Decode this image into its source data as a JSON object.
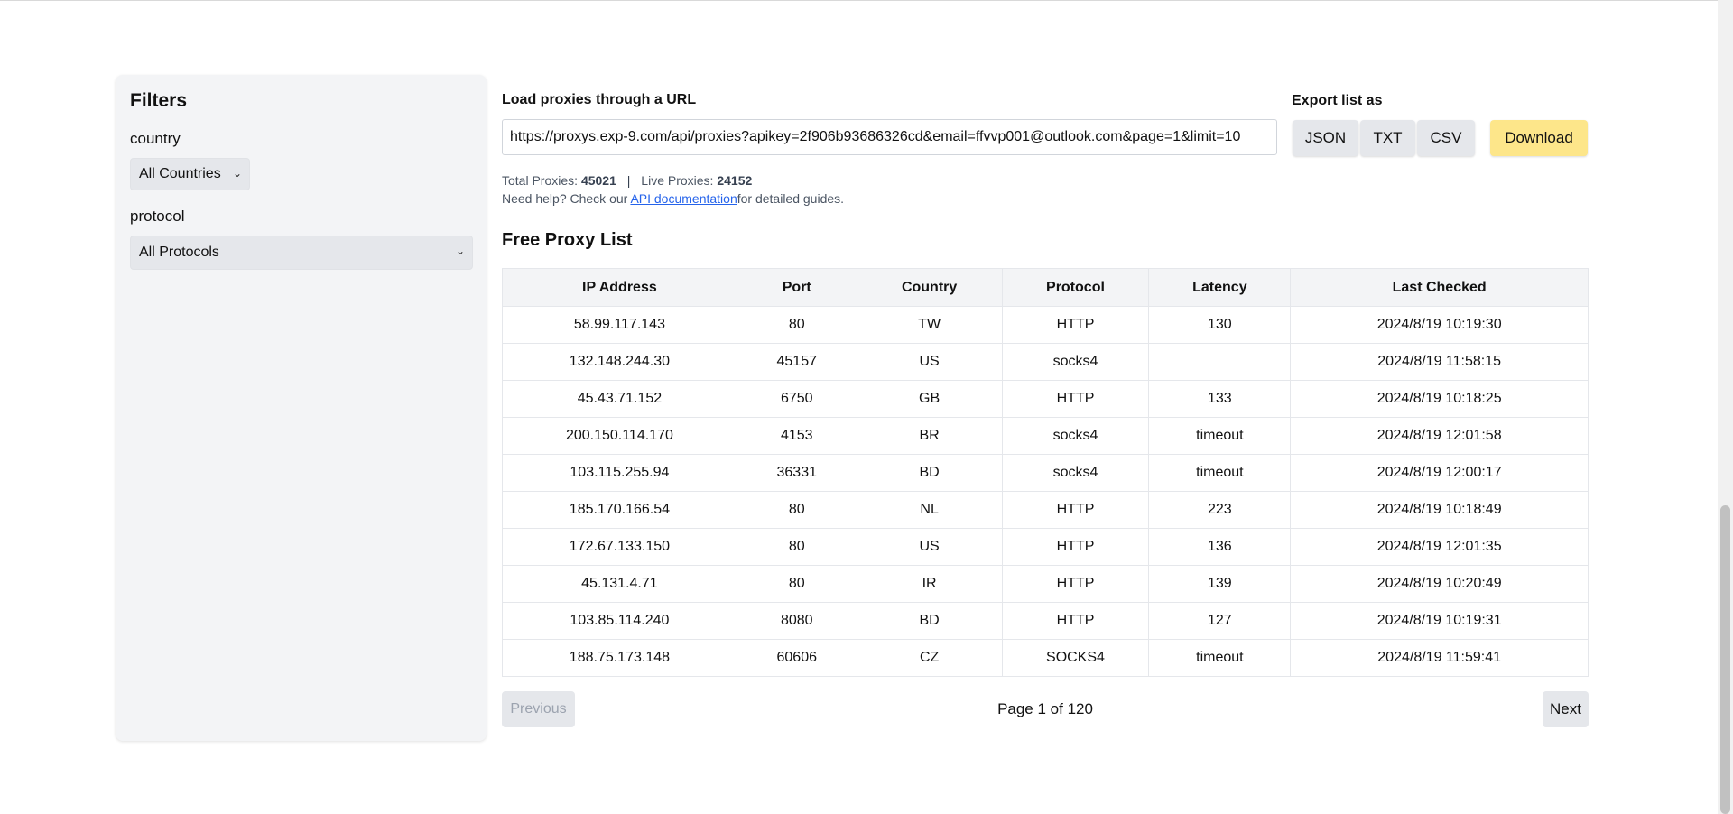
{
  "filters": {
    "title": "Filters",
    "country_label": "country",
    "country_value": "All Countries",
    "protocol_label": "protocol",
    "protocol_value": "All Protocols"
  },
  "url_loader": {
    "label": "Load proxies through a URL",
    "value": "https://proxys.exp-9.com/api/proxies?apikey=2f906b93686326cd&email=ffvvp001@outlook.com&page=1&limit=10"
  },
  "export": {
    "label": "Export list as",
    "formats": [
      "JSON",
      "TXT",
      "CSV"
    ],
    "download_label": "Download"
  },
  "stats": {
    "total_label": "Total Proxies:",
    "total_value": "45021",
    "separator": "|",
    "live_label": "Live Proxies:",
    "live_value": "24152"
  },
  "help": {
    "prefix": "Need help? Check our ",
    "link_text": "API documentation",
    "suffix": "for detailed guides."
  },
  "list_title": "Free Proxy List",
  "table": {
    "headers": [
      "IP Address",
      "Port",
      "Country",
      "Protocol",
      "Latency",
      "Last Checked"
    ],
    "rows": [
      [
        "58.99.117.143",
        "80",
        "TW",
        "HTTP",
        "130",
        "2024/8/19 10:19:30"
      ],
      [
        "132.148.244.30",
        "45157",
        "US",
        "socks4",
        "",
        "2024/8/19 11:58:15"
      ],
      [
        "45.43.71.152",
        "6750",
        "GB",
        "HTTP",
        "133",
        "2024/8/19 10:18:25"
      ],
      [
        "200.150.114.170",
        "4153",
        "BR",
        "socks4",
        "timeout",
        "2024/8/19 12:01:58"
      ],
      [
        "103.115.255.94",
        "36331",
        "BD",
        "socks4",
        "timeout",
        "2024/8/19 12:00:17"
      ],
      [
        "185.170.166.54",
        "80",
        "NL",
        "HTTP",
        "223",
        "2024/8/19 10:18:49"
      ],
      [
        "172.67.133.150",
        "80",
        "US",
        "HTTP",
        "136",
        "2024/8/19 12:01:35"
      ],
      [
        "45.131.4.71",
        "80",
        "IR",
        "HTTP",
        "139",
        "2024/8/19 10:20:49"
      ],
      [
        "103.85.114.240",
        "8080",
        "BD",
        "HTTP",
        "127",
        "2024/8/19 10:19:31"
      ],
      [
        "188.75.173.148",
        "60606",
        "CZ",
        "SOCKS4",
        "timeout",
        "2024/8/19 11:59:41"
      ]
    ]
  },
  "pagination": {
    "previous_label": "Previous",
    "info": "Page 1 of 120",
    "next_label": "Next"
  },
  "colors": {
    "download_bg": "#fde68a",
    "link": "#2563eb",
    "panel_bg": "#f3f4f6"
  }
}
